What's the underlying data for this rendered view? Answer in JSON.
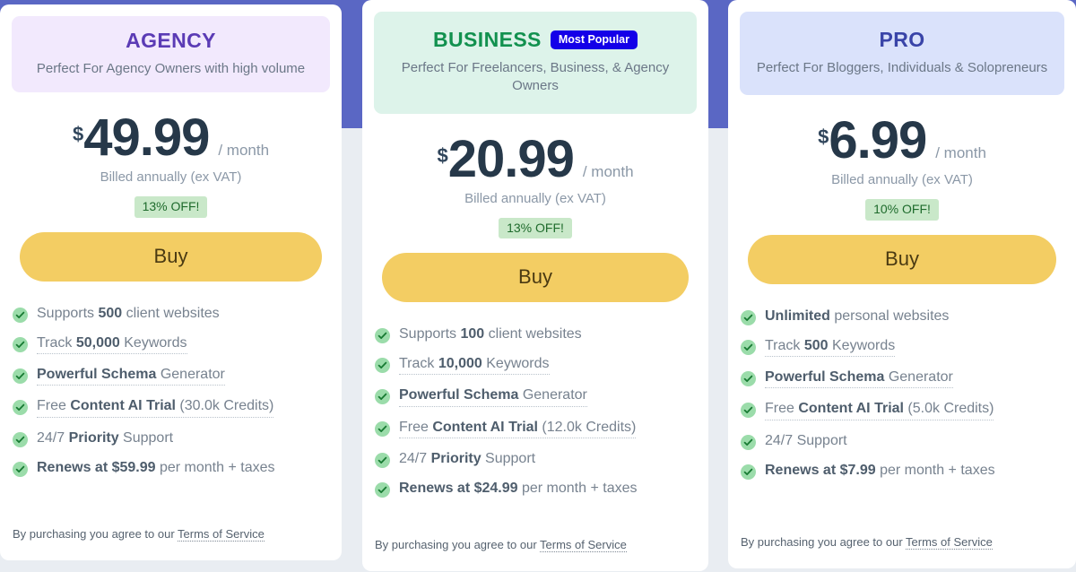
{
  "background": {
    "top_band_color": "#5a67c4",
    "bottom_color": "#e9edf2"
  },
  "plans": [
    {
      "id": "agency",
      "title": "AGENCY",
      "title_color": "#5b3bb5",
      "header_bg": "#f2e9fd",
      "badge": null,
      "subtitle": "Perfect For Agency Owners with high volume",
      "currency": "$",
      "amount": "49.99",
      "period": "/ month",
      "billing_note": "Billed annually (ex VAT)",
      "discount": "13% OFF!",
      "buy_label": "Buy",
      "features": [
        {
          "parts": [
            {
              "t": "Supports ",
              "b": false
            },
            {
              "t": "500",
              "b": true
            },
            {
              "t": " client websites",
              "b": false
            }
          ],
          "dotted": false
        },
        {
          "parts": [
            {
              "t": "Track ",
              "b": false
            },
            {
              "t": "50,000",
              "b": true
            },
            {
              "t": " Keywords",
              "b": false
            }
          ],
          "dotted": true
        },
        {
          "parts": [
            {
              "t": "Powerful Schema",
              "b": true
            },
            {
              "t": " Generator",
              "b": false
            }
          ],
          "dotted": true
        },
        {
          "parts": [
            {
              "t": "Free ",
              "b": false
            },
            {
              "t": "Content AI Trial",
              "b": true
            },
            {
              "t": " (30.0k Credits)",
              "b": false
            }
          ],
          "dotted": true
        },
        {
          "parts": [
            {
              "t": "24/7 ",
              "b": false
            },
            {
              "t": "Priority",
              "b": true
            },
            {
              "t": " Support",
              "b": false
            }
          ],
          "dotted": false
        },
        {
          "parts": [
            {
              "t": "Renews at $59.99",
              "b": true
            },
            {
              "t": " per month + taxes",
              "b": false
            }
          ],
          "dotted": false
        }
      ],
      "terms_prefix": "By purchasing you agree to our ",
      "terms_link": "Terms of Service"
    },
    {
      "id": "business",
      "title": "BUSINESS",
      "title_color": "#12914f",
      "header_bg": "#ddf3ea",
      "badge": "Most Popular",
      "badge_bg": "#1400e8",
      "subtitle": "Perfect For Freelancers, Business, & Agency Owners",
      "currency": "$",
      "amount": "20.99",
      "period": "/ month",
      "billing_note": "Billed annually (ex VAT)",
      "discount": "13% OFF!",
      "buy_label": "Buy",
      "features": [
        {
          "parts": [
            {
              "t": "Supports ",
              "b": false
            },
            {
              "t": "100",
              "b": true
            },
            {
              "t": " client websites",
              "b": false
            }
          ],
          "dotted": false
        },
        {
          "parts": [
            {
              "t": "Track ",
              "b": false
            },
            {
              "t": "10,000",
              "b": true
            },
            {
              "t": " Keywords",
              "b": false
            }
          ],
          "dotted": true
        },
        {
          "parts": [
            {
              "t": "Powerful Schema",
              "b": true
            },
            {
              "t": " Generator",
              "b": false
            }
          ],
          "dotted": true
        },
        {
          "parts": [
            {
              "t": "Free ",
              "b": false
            },
            {
              "t": "Content AI Trial",
              "b": true
            },
            {
              "t": " (12.0k Credits)",
              "b": false
            }
          ],
          "dotted": true
        },
        {
          "parts": [
            {
              "t": "24/7 ",
              "b": false
            },
            {
              "t": "Priority",
              "b": true
            },
            {
              "t": " Support",
              "b": false
            }
          ],
          "dotted": false
        },
        {
          "parts": [
            {
              "t": "Renews at $24.99",
              "b": true
            },
            {
              "t": " per month + taxes",
              "b": false
            }
          ],
          "dotted": false
        }
      ],
      "terms_prefix": "By purchasing you agree to our ",
      "terms_link": "Terms of Service"
    },
    {
      "id": "pro",
      "title": "PRO",
      "title_color": "#3944a8",
      "header_bg": "#dae2fb",
      "badge": null,
      "subtitle": "Perfect For Bloggers, Individuals & Solopreneurs",
      "currency": "$",
      "amount": "6.99",
      "period": "/ month",
      "billing_note": "Billed annually (ex VAT)",
      "discount": "10% OFF!",
      "buy_label": "Buy",
      "features": [
        {
          "parts": [
            {
              "t": "Unlimited",
              "b": true
            },
            {
              "t": " personal websites",
              "b": false
            }
          ],
          "dotted": false
        },
        {
          "parts": [
            {
              "t": "Track ",
              "b": false
            },
            {
              "t": "500",
              "b": true
            },
            {
              "t": " Keywords",
              "b": false
            }
          ],
          "dotted": true
        },
        {
          "parts": [
            {
              "t": "Powerful Schema",
              "b": true
            },
            {
              "t": " Generator",
              "b": false
            }
          ],
          "dotted": true
        },
        {
          "parts": [
            {
              "t": "Free ",
              "b": false
            },
            {
              "t": "Content AI Trial",
              "b": true
            },
            {
              "t": " (5.0k Credits)",
              "b": false
            }
          ],
          "dotted": true
        },
        {
          "parts": [
            {
              "t": "24/7 Support",
              "b": false
            }
          ],
          "dotted": false
        },
        {
          "parts": [
            {
              "t": "Renews at $7.99",
              "b": true
            },
            {
              "t": " per month + taxes",
              "b": false
            }
          ],
          "dotted": false
        }
      ],
      "terms_prefix": "By purchasing you agree to our ",
      "terms_link": "Terms of Service"
    }
  ],
  "icons": {
    "check": "check-circle-icon"
  },
  "colors": {
    "buy_button_bg": "#f3cd63",
    "buy_button_text": "#4a3a12",
    "discount_bg": "#c9e8c9",
    "discount_text": "#1e6b2c",
    "price_text": "#263849",
    "check_circle": "#9bdcaa",
    "check_mark": "#177a32"
  }
}
